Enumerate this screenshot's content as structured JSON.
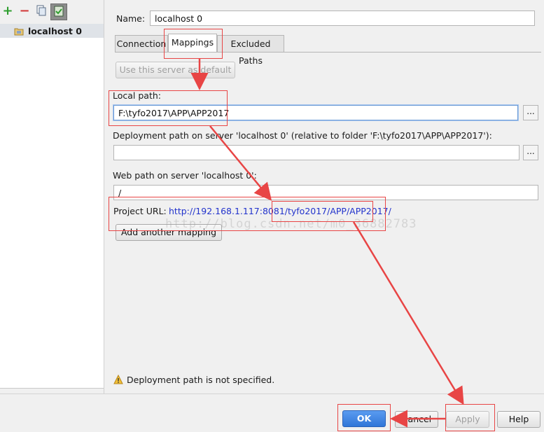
{
  "toolbar": {
    "add_icon": "plus-icon",
    "remove_icon": "minus-icon",
    "copy_icon": "copy-icon",
    "default_icon": "server-check-icon"
  },
  "tree": {
    "items": [
      {
        "label": "localhost 0",
        "icon": "server-folder-icon"
      }
    ]
  },
  "form": {
    "name_label": "Name:",
    "name_value": "localhost 0",
    "tabs": [
      {
        "label": "Connection"
      },
      {
        "label": "Mappings"
      },
      {
        "label": "Excluded Paths"
      }
    ],
    "active_tab": "Mappings",
    "use_default_label": "Use this server as default",
    "local_path_label": "Local path:",
    "local_path_value": "F:\\tyfo2017\\APP\\APP2017",
    "deployment_path_label": "Deployment path on server 'localhost 0' (relative to folder 'F:\\tyfo2017\\APP\\APP2017'):",
    "deployment_path_value": "",
    "web_path_label": "Web path on server 'localhost 0':",
    "web_path_value": "/",
    "project_url_label": "Project URL:",
    "project_url_value": "http://192.168.1.117:8081/tyfo2017/APP/APP2017/",
    "add_mapping_label": "Add another mapping",
    "browse_label": "...",
    "warning_text": "Deployment path is not specified."
  },
  "buttons": {
    "ok": "OK",
    "cancel": "Cancel",
    "apply": "Apply",
    "help": "Help"
  },
  "watermark": "http://blog.csdn.net/m0_36882783",
  "colors": {
    "annotation_red": "#e84545",
    "link_blue": "#2233cc",
    "primary_blue": "#2f76d8"
  }
}
